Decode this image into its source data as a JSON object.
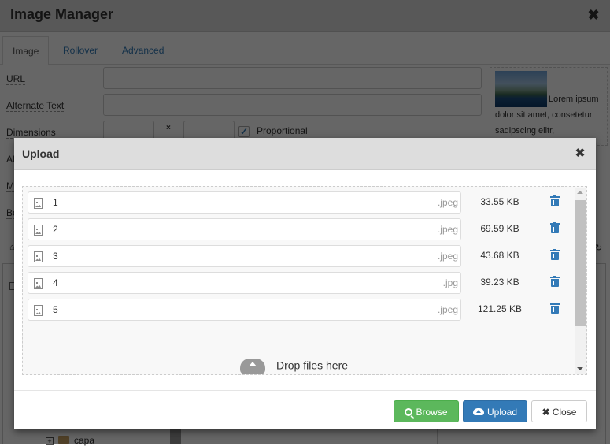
{
  "image_manager": {
    "title": "Image Manager",
    "close_glyph": "✖",
    "tabs": [
      {
        "label": "Image",
        "active": true
      },
      {
        "label": "Rollover",
        "active": false
      },
      {
        "label": "Advanced",
        "active": false
      }
    ],
    "fields": {
      "url_label": "URL",
      "alt_label": "Alternate Text",
      "dimensions_label": "Dimensions",
      "dimensions_times": "×",
      "proportional_label": "Proportional",
      "proportional_checked": true,
      "align_label_partial": "Al",
      "margin_label_partial": "M",
      "border_label_partial": "Bo"
    },
    "preview_text": "Lorem ipsum dolor sit amet, consetetur sadipscing elitr,",
    "tree": {
      "visible_item": "capa"
    }
  },
  "upload_dialog": {
    "title": "Upload",
    "close_glyph": "✖",
    "files": [
      {
        "name": "1",
        "ext": ".jpeg",
        "size": "33.55 KB"
      },
      {
        "name": "2",
        "ext": ".jpeg",
        "size": "69.59 KB"
      },
      {
        "name": "3",
        "ext": ".jpeg",
        "size": "43.68 KB"
      },
      {
        "name": "4",
        "ext": ".jpg",
        "size": "39.23 KB"
      },
      {
        "name": "5",
        "ext": ".jpeg",
        "size": "121.25 KB"
      }
    ],
    "drop_message": "Drop files here",
    "buttons": {
      "browse": "Browse",
      "upload": "Upload",
      "close": "Close",
      "close_glyph": "✖"
    },
    "colors": {
      "browse": "#5cb85c",
      "upload": "#337ab7",
      "delete_icon": "#337ab7"
    }
  }
}
